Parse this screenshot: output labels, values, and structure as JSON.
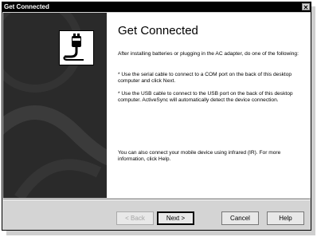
{
  "window": {
    "title": "Get Connected",
    "close_glyph": "✕"
  },
  "main": {
    "heading": "Get Connected",
    "intro": "After installing batteries or plugging in the AC adapter, do one of the following:",
    "bullet_serial": "* Use the serial cable to connect to a COM port on the back of this desktop computer and click Next.",
    "bullet_usb": "* Use the USB cable to connect to the USB port on the back of this desktop computer.  ActiveSync will automatically detect the device connection.",
    "infrared": "You can also connect your mobile device using infrared (IR). For more information, click Help."
  },
  "buttons": {
    "back": "< Back",
    "next": "Next >",
    "cancel": "Cancel",
    "help": "Help"
  },
  "icons": {
    "logo": "cable-plug-icon"
  },
  "colors": {
    "panel": "#2a2a2a",
    "titlebar": "#000000"
  }
}
